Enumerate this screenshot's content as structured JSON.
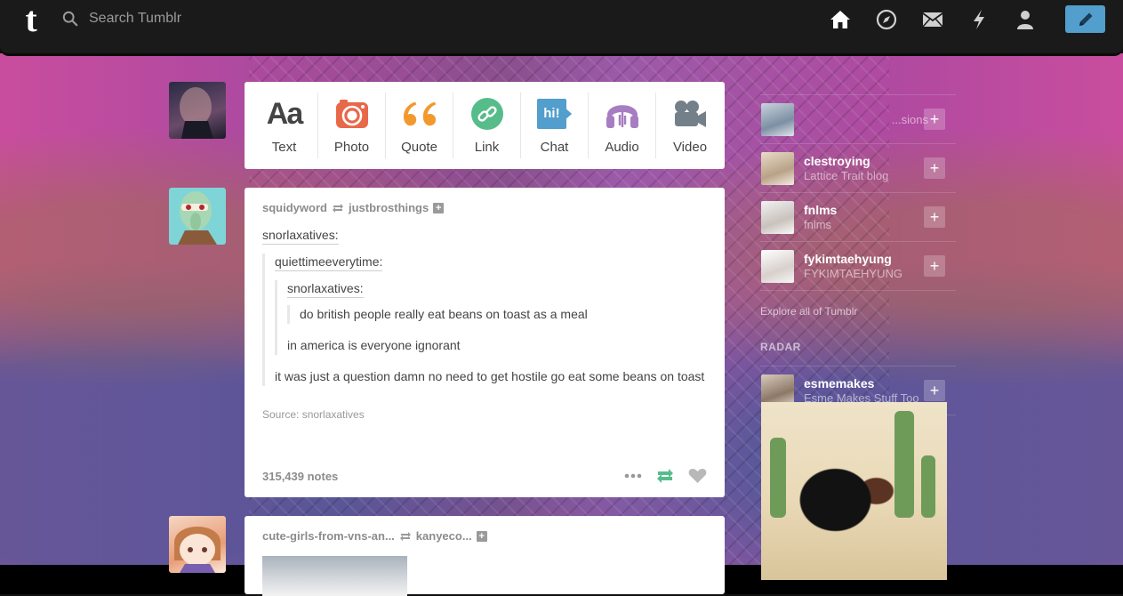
{
  "app": {
    "logo_letter": "t"
  },
  "search": {
    "placeholder": "Search Tumblr",
    "value": ""
  },
  "nav": {
    "icons": [
      "home-icon",
      "explore-compass-icon",
      "inbox-mail-icon",
      "activity-bolt-icon",
      "account-person-icon"
    ],
    "compose_icon": "pencil-icon",
    "accent_color": "#529ecc"
  },
  "composer": {
    "types": [
      {
        "label": "Text",
        "glyph": "Aa",
        "color": "#444444"
      },
      {
        "label": "Photo",
        "color": "#e8684a"
      },
      {
        "label": "Quote",
        "glyph": "“",
        "color": "#f2992e"
      },
      {
        "label": "Link",
        "color": "#56bc8a"
      },
      {
        "label": "Chat",
        "glyph": "hi!",
        "color": "#529ecc"
      },
      {
        "label": "Audio",
        "color": "#a77dc2"
      },
      {
        "label": "Video",
        "color": "#748089"
      }
    ]
  },
  "post": {
    "author": "squidyword",
    "reblogged_from": "justbrosthings",
    "trail_user_1": "snorlaxatives:",
    "trail_user_2": "quiettimeeverytime:",
    "trail_user_3": "snorlaxatives:",
    "text_1": "do british people really eat beans on toast as a meal",
    "text_2": "in america is everyone ignorant",
    "text_3": "it was just a question damn no need to get hostile go eat some beans on toast",
    "source": "Source: snorlaxatives",
    "notes": "315,439 notes"
  },
  "post2": {
    "author": "cute-girls-from-vns-an...",
    "reblogged_from": "kanyeco..."
  },
  "sidebar": {
    "recommended": [
      {
        "name": "",
        "sub": "...sions",
        "avatar_color": "#8ea3b8"
      },
      {
        "name": "clestroying",
        "sub": "Lattice Trait blog",
        "avatar_color": "#c9b59a"
      },
      {
        "name": "fnlms",
        "sub": "fnlms",
        "avatar_color": "#d6d6d6"
      },
      {
        "name": "fykimtaehyung",
        "sub": "FYKIMTAEHYUNG",
        "avatar_color": "#e8e8e8"
      }
    ],
    "explore_link": "Explore all of Tumblr",
    "radar_title": "RADAR",
    "radar": {
      "name": "esmemakes",
      "sub": "Esme Makes Stuff Too",
      "avatar_color": "#b9a79a"
    }
  }
}
